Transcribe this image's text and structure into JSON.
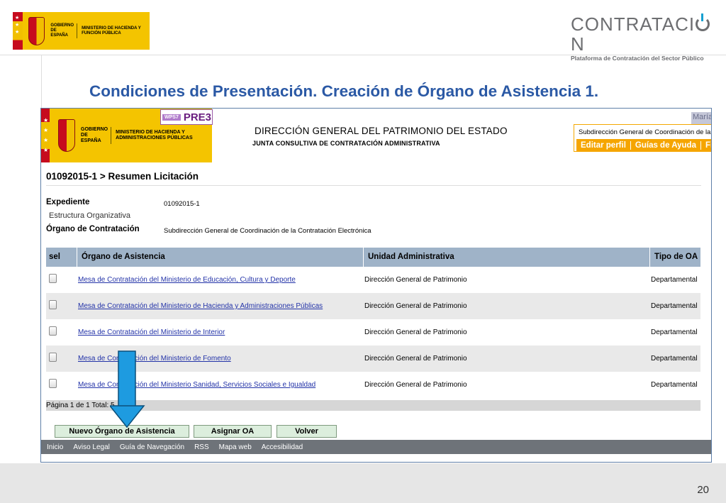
{
  "slide": {
    "title": "Condiciones de Presentación. Creación de Órgano de Asistencia 1.",
    "page_number": "20",
    "gov_logo": {
      "line1": "GOBIERNO DE ESPAÑA",
      "line2": "MINISTERIO DE HACIENDA Y FUNCIÓN PÚBLICA"
    },
    "brand": {
      "name_left": "CONTRATACI",
      "name_right": "N",
      "subtitle": "Plataforma de Contratación del Sector Público"
    }
  },
  "app": {
    "logo": {
      "gov": "GOBIERNO DE ESPAÑA",
      "ministry": "MINISTERIO DE HACIENDA Y ADMINISTRACIONES PÚBLICAS"
    },
    "env_tag": "WPS7",
    "env_name": "PRE3",
    "directorate": "DIRECCIÓN GENERAL DEL PATRIMONIO DEL ESTADO",
    "board": "JUNTA CONSULTIVA DE CONTRATACIÓN ADMINISTRATIVA",
    "user": {
      "name": "María",
      "org": "Subdirección General de Coordinación de la",
      "menu": [
        "Editar perfil",
        "Guías de Ayuda",
        "Fina"
      ]
    },
    "breadcrumb": "01092015-1 > Resumen Licitación",
    "info": {
      "expediente_label": "Expediente",
      "expediente_value": "01092015-1",
      "estructura_label": "Estructura Organizativa",
      "organo_label": "Órgano de Contratación",
      "organo_value": "Subdirección General de Coordinación de la Contratación Electrónica"
    },
    "table": {
      "headers": {
        "sel": "sel",
        "organo": "Órgano de Asistencia",
        "unidad": "Unidad Administrativa",
        "tipo": "Tipo de OA"
      },
      "rows": [
        {
          "organo": "Mesa de Contratación del Ministerio de Educación, Cultura y Deporte",
          "unidad": "Dirección General de Patrimonio",
          "tipo": "Departamental"
        },
        {
          "organo": "Mesa de Contratación del Ministerio de Hacienda y Administraciones Públicas",
          "unidad": "Dirección General de Patrimonio",
          "tipo": "Departamental"
        },
        {
          "organo": "Mesa de Contratación del Ministerio de Interior",
          "unidad": "Dirección General de Patrimonio",
          "tipo": "Departamental"
        },
        {
          "organo": "Mesa de Contratación del Ministerio de Fomento",
          "unidad": "Dirección General de Patrimonio",
          "tipo": "Departamental"
        },
        {
          "organo": "Mesa de Contratación del Ministerio Sanidad, Servicios Sociales e Igualdad",
          "unidad": "Dirección General de Patrimonio",
          "tipo": "Departamental"
        }
      ],
      "pager": "Página 1 de 1 Total: 5"
    },
    "buttons": {
      "nuevo": "Nuevo Órgano de Asistencia",
      "asignar": "Asignar OA",
      "volver": "Volver"
    },
    "footer": [
      "Inicio",
      "Aviso Legal",
      "Guía de Navegación",
      "RSS",
      "Mapa web",
      "Accesibilidad"
    ]
  },
  "colors": {
    "title": "#2b59a5",
    "arrow": "#1e9be0",
    "menu": "#f5a500",
    "table_header": "#9fb3c8"
  }
}
